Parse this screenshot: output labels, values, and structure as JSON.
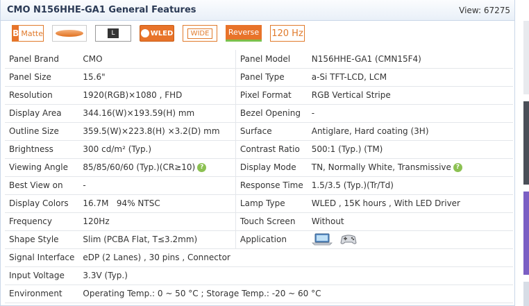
{
  "header": {
    "title": "CMO N156HHE-GA1 General Features",
    "views": "View: 67275"
  },
  "badges": {
    "matte_mark": "B",
    "matte": "Matte",
    "aspect": "L",
    "wled": "WLED",
    "wide": "WIDE",
    "reverse": "Reverse",
    "hz": "120 Hz"
  },
  "specs": {
    "rows": [
      {
        "l1": "Panel Brand",
        "v1": "CMO",
        "l2": "Panel Model",
        "v2": "N156HHE-GA1 (CMN15F4)"
      },
      {
        "l1": "Panel Size",
        "v1": "15.6\"",
        "l2": "Panel Type",
        "v2": "a-Si TFT-LCD, LCM"
      },
      {
        "l1": "Resolution",
        "v1": "1920(RGB)×1080 , FHD",
        "l2": "Pixel Format",
        "v2": "RGB Vertical Stripe"
      },
      {
        "l1": "Display Area",
        "v1": "344.16(W)×193.59(H) mm",
        "l2": "Bezel Opening",
        "v2": "-"
      },
      {
        "l1": "Outline Size",
        "v1": "359.5(W)×223.8(H) ×3.2(D) mm",
        "l2": "Surface",
        "v2": "Antiglare, Hard coating (3H)"
      },
      {
        "l1": "Brightness",
        "v1": "300 cd/m² (Typ.)",
        "l2": "Contrast Ratio",
        "v2": "500:1 (Typ.) (TM)"
      },
      {
        "l1": "Viewing Angle",
        "v1": "85/85/60/60 (Typ.)(CR≥10)",
        "l2": "Display Mode",
        "v2": "TN, Normally White, Transmissive"
      },
      {
        "l1": "Best View on",
        "v1": "-",
        "l2": "Response Time",
        "v2": "1.5/3.5 (Typ.)(Tr/Td)"
      },
      {
        "l1": "Display Colors",
        "v1": "16.7M   94% NTSC",
        "l2": "Lamp Type",
        "v2": "WLED , 15K hours , With LED Driver"
      },
      {
        "l1": "Frequency",
        "v1": "120Hz",
        "l2": "Touch Screen",
        "v2": "Without"
      },
      {
        "l1": "Shape Style",
        "v1": "Slim (PCBA Flat, T≤3.2mm)",
        "l2": "Application",
        "v2": ""
      },
      {
        "l1": "Signal Interface",
        "v1": "eDP (2 Lanes) , 30 pins , Connector"
      },
      {
        "l1": "Input Voltage",
        "v1": "3.3V (Typ.)"
      },
      {
        "l1": "Environment",
        "v1": "Operating Temp.: 0 ~ 50 °C ; Storage Temp.: -20 ~ 60 °C"
      }
    ]
  },
  "icons": {
    "help": "?",
    "application": [
      "laptop-icon",
      "gamepad-icon"
    ]
  },
  "colors": {
    "accent": "#e8732a",
    "header_text": "#2b3a55",
    "help_green": "#8cc152"
  }
}
